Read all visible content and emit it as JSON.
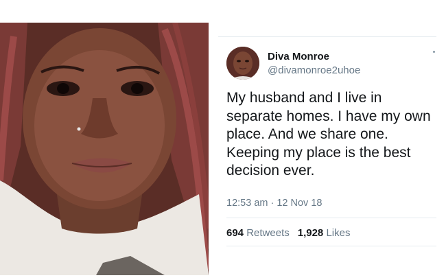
{
  "tweet": {
    "display_name": "Diva Monroe",
    "handle": "@divamonroe2uhoe",
    "text": "My husband and I live in separate homes. I have my own place. And we share one. Keeping my place is the best decision ever.",
    "timestamp": "12:53 am · 12 Nov 18",
    "retweets_count": "694",
    "retweets_label": "Retweets",
    "likes_count": "1,928",
    "likes_label": "Likes"
  },
  "colors": {
    "text_primary": "#14171a",
    "text_secondary": "#657786",
    "divider": "#e6ecf0"
  },
  "icons": {
    "menu": "more-dot-icon"
  }
}
